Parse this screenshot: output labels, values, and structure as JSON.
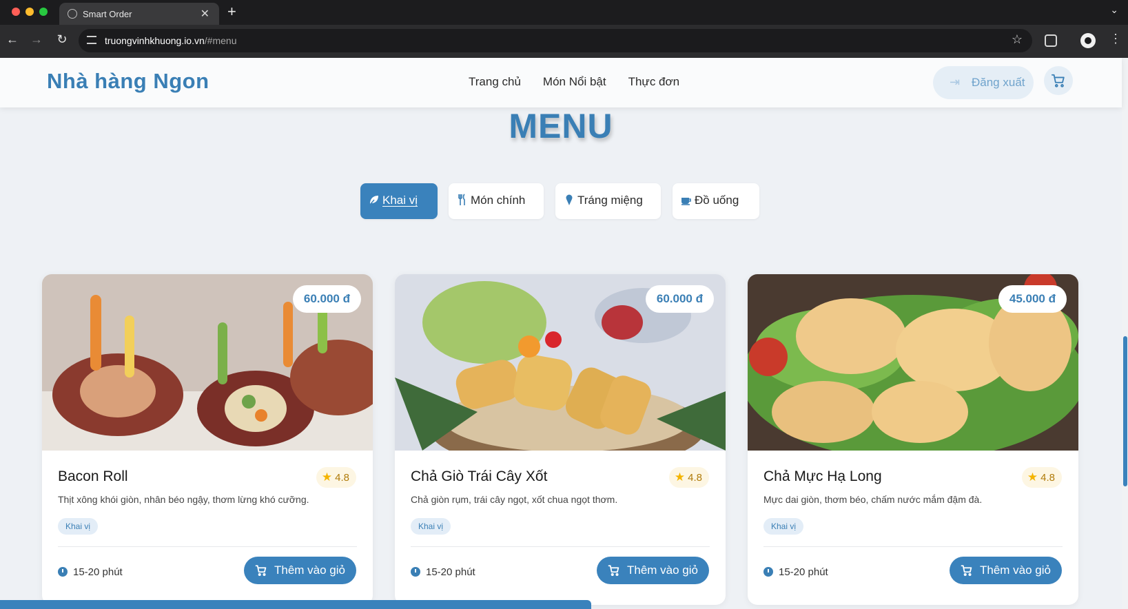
{
  "browser": {
    "tab_title": "Smart Order",
    "url_host": "truongvinhkhuong.io.vn",
    "url_path": "/#menu",
    "icons": [
      "globe-icon",
      "close-icon",
      "plus-icon",
      "back-icon",
      "forward-icon",
      "reload-icon",
      "star-icon",
      "extension-icon",
      "profile-icon",
      "kebab-icon"
    ]
  },
  "header": {
    "brand": "Nhà hàng Ngon",
    "nav": [
      "Trang chủ",
      "Món Nổi bật",
      "Thực đơn"
    ],
    "logout_label": "Đăng xuất",
    "cart_icon": "cart-icon",
    "accent_color": "#3a7fb5"
  },
  "menu": {
    "title": "MENU",
    "tabs": [
      {
        "label": "Khai vị",
        "icon": "leaf-icon",
        "active": true
      },
      {
        "label": "Món chính",
        "icon": "utensils-icon",
        "active": false
      },
      {
        "label": "Tráng miệng",
        "icon": "ice-cream-icon",
        "active": false
      },
      {
        "label": "Đồ uống",
        "icon": "coffee-icon",
        "active": false
      }
    ],
    "items": [
      {
        "name": "Bacon Roll",
        "price": "60.000 đ",
        "rating": "4.8",
        "description": "Thịt xông khói giòn, nhân béo ngậy, thơm lừng khó cưỡng.",
        "category": "Khai vị",
        "time": "15-20 phút",
        "add_label": "Thêm vào giỏ"
      },
      {
        "name": "Chả Giò Trái Cây Xốt",
        "price": "60.000 đ",
        "rating": "4.8",
        "description": "Chả giòn rụm, trái cây ngọt, xốt chua ngọt thơm.",
        "category": "Khai vị",
        "time": "15-20 phút",
        "add_label": "Thêm vào giỏ"
      },
      {
        "name": "Chả Mực Hạ Long",
        "price": "45.000 đ",
        "rating": "4.8",
        "description": "Mực dai giòn, thơm béo, chấm nước mắm đậm đà.",
        "category": "Khai vị",
        "time": "15-20 phút",
        "add_label": "Thêm vào giỏ"
      }
    ]
  }
}
